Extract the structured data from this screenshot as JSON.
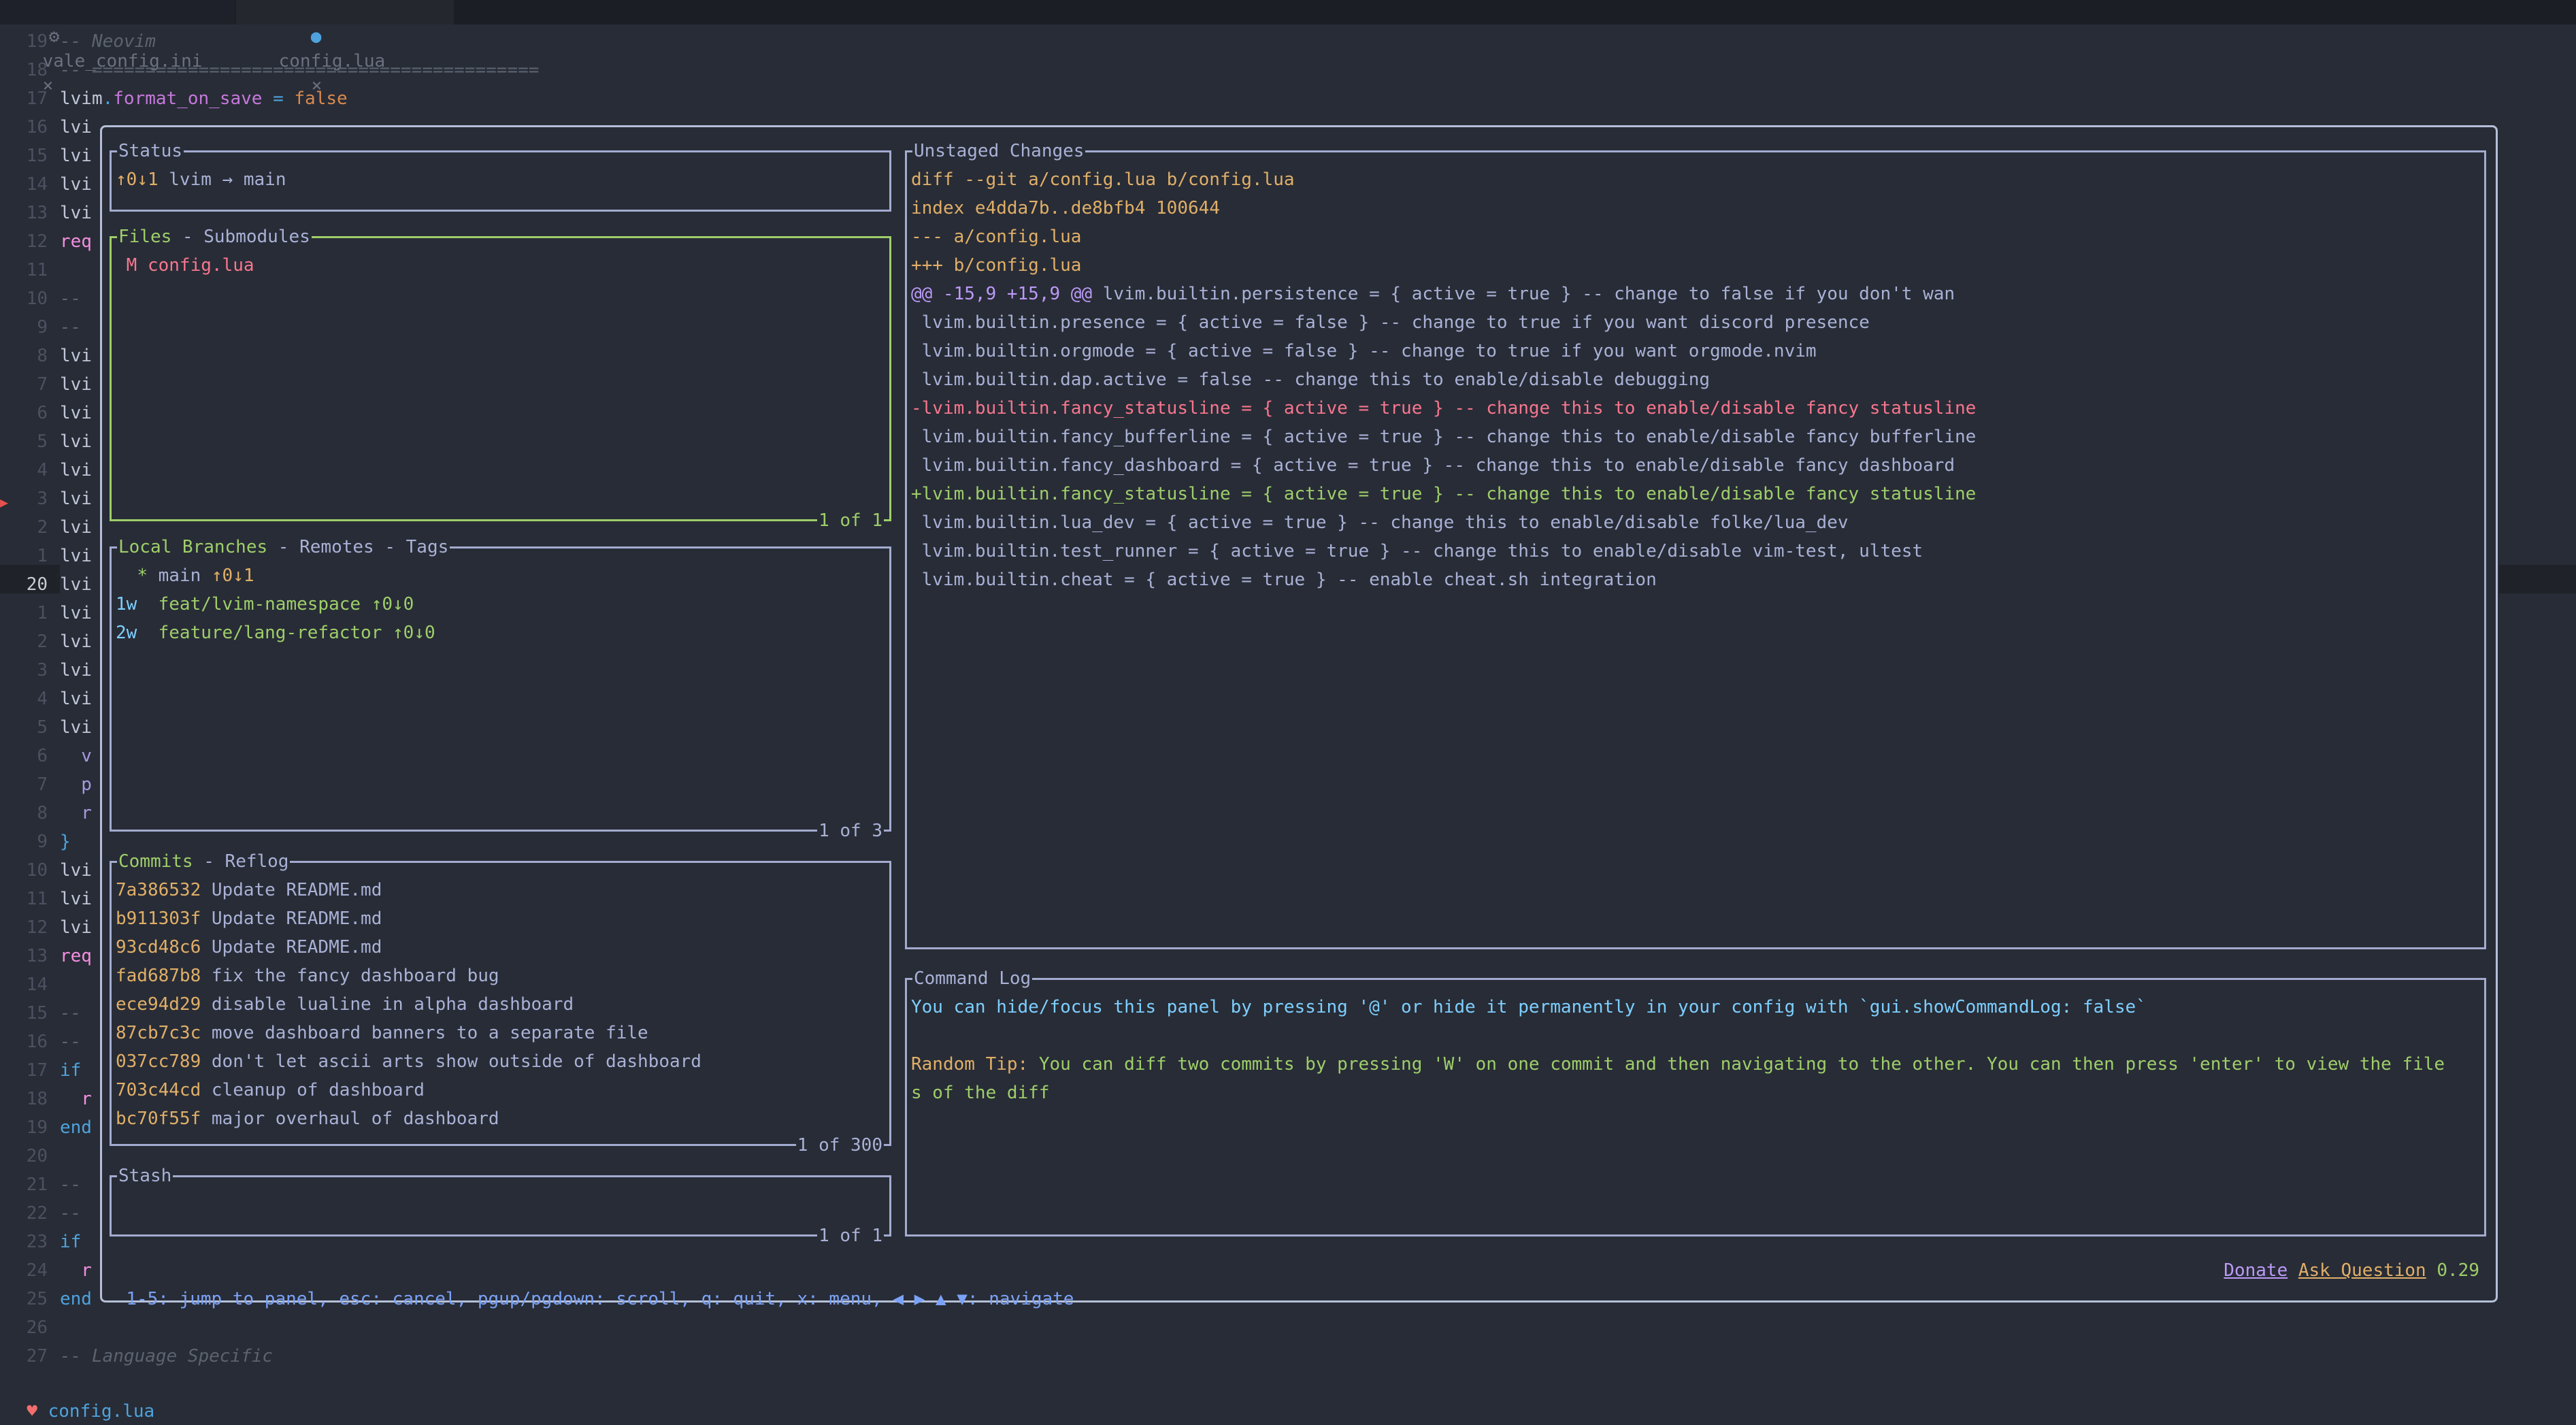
{
  "tabs": [
    {
      "icon": "gear-icon",
      "label": "vale_config.ini",
      "close": "×"
    },
    {
      "icon": "lua-icon",
      "label": "config.lua",
      "close": "×",
      "active": true
    }
  ],
  "editor": {
    "lines": [
      {
        "num": "19",
        "text": "-- Neovim",
        "type": "comment"
      },
      {
        "num": "18",
        "text": "-- ==========================================",
        "type": "comment"
      },
      {
        "num": "17",
        "parts": [
          "lvim",
          ".",
          "format_on_save",
          " = ",
          "false"
        ]
      },
      {
        "num": "16",
        "text": "lvi"
      },
      {
        "num": "15",
        "text": "lvi"
      },
      {
        "num": "14",
        "text": "lvi"
      },
      {
        "num": "13",
        "text": "lvi"
      },
      {
        "num": "12",
        "text": "req",
        "type": "req"
      },
      {
        "num": "11",
        "text": ""
      },
      {
        "num": "10",
        "text": "--",
        "type": "comment"
      },
      {
        "num": "9",
        "text": "--",
        "type": "comment"
      },
      {
        "num": "8",
        "text": "lvi"
      },
      {
        "num": "7",
        "text": "lvi"
      },
      {
        "num": "6",
        "text": "lvi"
      },
      {
        "num": "5",
        "text": "lvi"
      },
      {
        "num": "4",
        "text": "lvi"
      },
      {
        "num": "3",
        "text": "lvi"
      },
      {
        "num": "2",
        "text": "lvi"
      },
      {
        "num": "1",
        "text": "lvi"
      },
      {
        "num": "20",
        "text": "lvi",
        "current": true
      },
      {
        "num": "1",
        "text": "lvi"
      },
      {
        "num": "2",
        "text": "lvi"
      },
      {
        "num": "3",
        "text": "lvi"
      },
      {
        "num": "4",
        "text": "lvi"
      },
      {
        "num": "5",
        "text": "lvi"
      },
      {
        "num": "6",
        "text": "  v",
        "type": "pur"
      },
      {
        "num": "7",
        "text": "  p",
        "type": "pur"
      },
      {
        "num": "8",
        "text": "  r",
        "type": "pur"
      },
      {
        "num": "9",
        "text": "}",
        "type": "kw"
      },
      {
        "num": "10",
        "text": "lvi"
      },
      {
        "num": "11",
        "text": "lvi"
      },
      {
        "num": "12",
        "text": "lvi"
      },
      {
        "num": "13",
        "text": "req",
        "type": "req"
      },
      {
        "num": "14",
        "text": ""
      },
      {
        "num": "15",
        "text": "--",
        "type": "comment"
      },
      {
        "num": "16",
        "text": "--",
        "type": "comment"
      },
      {
        "num": "17",
        "text": "if",
        "type": "kw"
      },
      {
        "num": "18",
        "text": "  r",
        "type": "req"
      },
      {
        "num": "19",
        "text": "end",
        "type": "kw"
      },
      {
        "num": "20",
        "text": ""
      },
      {
        "num": "21",
        "text": "--",
        "type": "comment"
      },
      {
        "num": "22",
        "text": "--",
        "type": "comment"
      },
      {
        "num": "23",
        "text": "if",
        "type": "kw"
      },
      {
        "num": "24",
        "text": "  r",
        "type": "req"
      },
      {
        "num": "25",
        "text": "end",
        "type": "kw"
      },
      {
        "num": "26",
        "text": ""
      },
      {
        "num": "27",
        "text": "-- Language Specific",
        "type": "comment"
      }
    ]
  },
  "lazygit": {
    "status": {
      "title": "Status",
      "ahead_behind": "↑0↓1",
      "text": "lvim → main"
    },
    "files": {
      "title_active": "Files",
      "title_rest": " - Submodules",
      "items": [
        {
          "status": "M",
          "name": "config.lua"
        }
      ],
      "footer": "1 of 1"
    },
    "branches": {
      "title_active": "Local Branches",
      "title_rest": " - Remotes - Tags",
      "items": [
        {
          "age": "",
          "marker": "*",
          "name": "main",
          "track": "↑0↓1",
          "current": true
        },
        {
          "age": "1w",
          "marker": "",
          "name": "feat/lvim-namespace",
          "track": "↑0↓0"
        },
        {
          "age": "2w",
          "marker": "",
          "name": "feature/lang-refactor",
          "track": "↑0↓0"
        }
      ],
      "footer": "1 of 3"
    },
    "commits": {
      "title_active": "Commits",
      "title_rest": " - Reflog",
      "items": [
        {
          "hash": "7a386532",
          "msg": "Update README.md"
        },
        {
          "hash": "b911303f",
          "msg": "Update README.md"
        },
        {
          "hash": "93cd48c6",
          "msg": "Update README.md"
        },
        {
          "hash": "fad687b8",
          "msg": "fix the fancy dashboard bug"
        },
        {
          "hash": "ece94d29",
          "msg": "disable lualine in alpha dashboard"
        },
        {
          "hash": "87cb7c3c",
          "msg": "move dashboard banners to a separate file"
        },
        {
          "hash": "037cc789",
          "msg": "don't let ascii arts show outside of dashboard"
        },
        {
          "hash": "703c44cd",
          "msg": "cleanup of dashboard"
        },
        {
          "hash": "bc70f55f",
          "msg": "major overhaul of dashboard"
        }
      ],
      "footer": "1 of 300"
    },
    "stash": {
      "title": "Stash",
      "footer": "1 of 1"
    },
    "diff": {
      "title": "Unstaged Changes",
      "lines": [
        {
          "type": "header",
          "text": "diff --git a/config.lua b/config.lua"
        },
        {
          "type": "header",
          "text": "index e4dda7b..de8bfb4 100644"
        },
        {
          "type": "header",
          "text": "--- a/config.lua"
        },
        {
          "type": "header",
          "text": "+++ b/config.lua"
        },
        {
          "type": "hunk",
          "hunk": "@@ -15,9 +15,9 @@",
          "text": " lvim.builtin.persistence = { active = true } -- change to false if you don't wan"
        },
        {
          "type": "ctx",
          "text": " lvim.builtin.presence = { active = false } -- change to true if you want discord presence"
        },
        {
          "type": "ctx",
          "text": " lvim.builtin.orgmode = { active = false } -- change to true if you want orgmode.nvim"
        },
        {
          "type": "ctx",
          "text": " lvim.builtin.dap.active = false -- change this to enable/disable debugging"
        },
        {
          "type": "del",
          "text": "-lvim.builtin.fancy_statusline = { active = true } -- change this to enable/disable fancy statusline"
        },
        {
          "type": "ctx",
          "text": " lvim.builtin.fancy_bufferline = { active = true } -- change this to enable/disable fancy bufferline"
        },
        {
          "type": "ctx",
          "text": " lvim.builtin.fancy_dashboard = { active = true } -- change this to enable/disable fancy dashboard"
        },
        {
          "type": "add",
          "text": "+lvim.builtin.fancy_statusline = { active = true } -- change this to enable/disable fancy statusline"
        },
        {
          "type": "ctx",
          "text": " lvim.builtin.lua_dev = { active = true } -- change this to enable/disable folke/lua_dev"
        },
        {
          "type": "ctx",
          "text": " lvim.builtin.test_runner = { active = true } -- change this to enable/disable vim-test, ultest"
        },
        {
          "type": "ctx",
          "text": " lvim.builtin.cheat = { active = true } -- enable cheat.sh integration"
        }
      ]
    },
    "command_log": {
      "title": "Command Log",
      "info": "You can hide/focus this panel by pressing '@' or hide it permanently in your config with `gui.showCommandLog: false`",
      "tip_label": "Random Tip:",
      "tip_line1": " You can diff two commits by pressing 'W' on one commit and then navigating to the other. You can then press 'enter' to view the file",
      "tip_line2": "s of the diff"
    },
    "keybindings": "1-5: jump to panel, esc: cancel, pgup/pgdown: scroll, q: quit, x: menu, ◀ ▶ ▲ ▼: navigate",
    "donate": "Donate",
    "ask_question": "Ask Question",
    "version": "0.29"
  },
  "statusline": {
    "icon": "devil-icon",
    "filename": "config.lua"
  }
}
